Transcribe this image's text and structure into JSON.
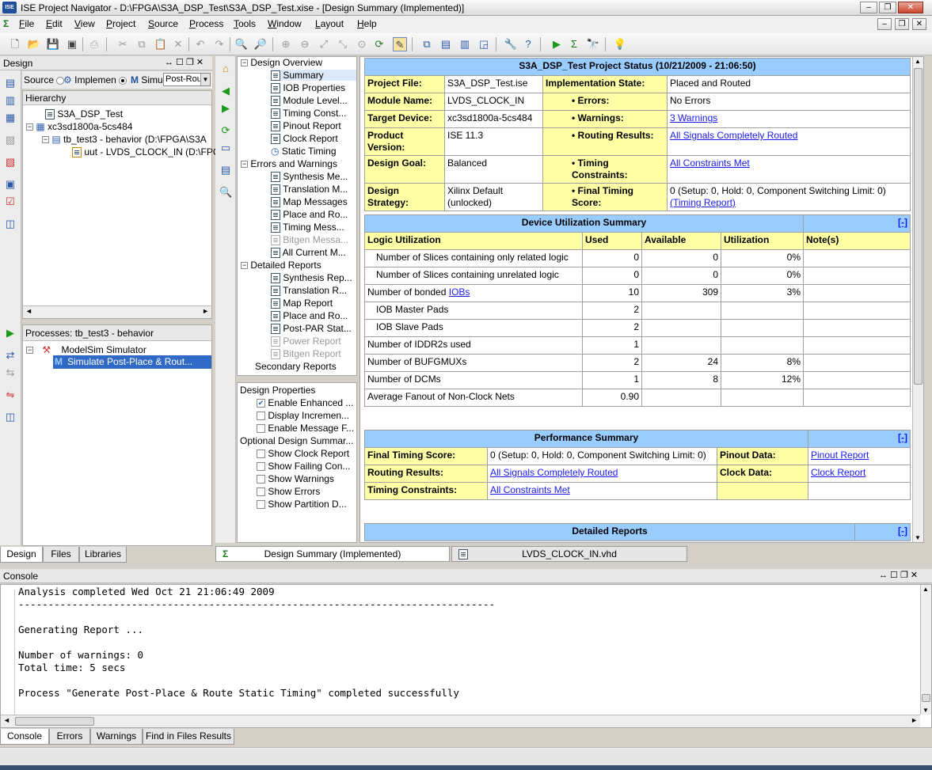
{
  "window": {
    "title": "ISE Project Navigator - D:\\FPGA\\S3A_DSP_Test\\S3A_DSP_Test.xise - [Design Summary (Implemented)]",
    "app_icon": "ISE"
  },
  "menu": [
    {
      "label": "File",
      "u": "F",
      "rest": "ile"
    },
    {
      "label": "Edit",
      "u": "E",
      "rest": "dit"
    },
    {
      "label": "View",
      "u": "V",
      "rest": "iew"
    },
    {
      "label": "Project",
      "u": "P",
      "rest": "roject"
    },
    {
      "label": "Source",
      "u": "S",
      "rest": "ource"
    },
    {
      "label": "Process",
      "u": "P",
      "rest": "rocess"
    },
    {
      "label": "Tools",
      "u": "T",
      "rest": "ools"
    },
    {
      "label": "Window",
      "u": "W",
      "rest": "indow"
    },
    {
      "label": "Layout",
      "u": "L",
      "rest": "ayout"
    },
    {
      "label": "Help",
      "u": "H",
      "rest": "elp"
    }
  ],
  "design_panel": {
    "title": "Design",
    "view_source_label": "Source",
    "view_impl_label": "Implemen",
    "sim_label": "Simu",
    "sim_select": "Post-Rou",
    "hierarchy_label": "Hierarchy",
    "tree": [
      "S3A_DSP_Test",
      "xc3sd1800a-5cs484",
      "tb_test3 - behavior (D:\\FPGA\\S3A",
      "uut - LVDS_CLOCK_IN (D:\\FPGA"
    ],
    "processes_label": "Processes: tb_test3 - behavior",
    "processes": [
      "ModelSim Simulator",
      "Simulate Post-Place & Rout..."
    ],
    "tabs": [
      "Design",
      "Files",
      "Libraries"
    ]
  },
  "summary_nav": {
    "design_overview": "Design Overview",
    "overview_items": [
      "Summary",
      "IOB Properties",
      "Module Level...",
      "Timing Const...",
      "Pinout Report",
      "Clock Report",
      "Static Timing"
    ],
    "errors_warnings": "Errors and Warnings",
    "ew_items": [
      "Synthesis Me...",
      "Translation M...",
      "Map Messages",
      "Place and Ro...",
      "Timing Mess...",
      "Bitgen Messa...",
      "All Current M..."
    ],
    "detailed_reports": "Detailed Reports",
    "dr_items": [
      "Synthesis Rep...",
      "Translation R...",
      "Map Report",
      "Place and Ro...",
      "Post-PAR Stat...",
      "Power Report",
      "Bitgen Report"
    ],
    "secondary_reports": "Secondary Reports",
    "design_properties": "Design Properties",
    "dp_items": [
      {
        "label": "Enable Enhanced ...",
        "checked": true
      },
      {
        "label": "Display Incremen...",
        "checked": false
      },
      {
        "label": "Enable Message F...",
        "checked": false
      }
    ],
    "optional_label": "Optional Design Summar...",
    "opt_items": [
      {
        "label": "Show Clock Report",
        "checked": false
      },
      {
        "label": "Show Failing Con...",
        "checked": false
      },
      {
        "label": "Show Warnings",
        "checked": false
      },
      {
        "label": "Show Errors",
        "checked": false
      },
      {
        "label": "Show Partition D...",
        "checked": false
      }
    ]
  },
  "project_status": {
    "title": "S3A_DSP_Test Project Status (10/21/2009 - 21:06:50)",
    "rows": [
      {
        "k1": "Project File:",
        "v1": "S3A_DSP_Test.ise",
        "k2": "Implementation State:",
        "v2": "Placed and Routed"
      },
      {
        "k1": "Module Name:",
        "v1": "LVDS_CLOCK_IN",
        "k2": "• Errors:",
        "v2": "No Errors"
      },
      {
        "k1": "Target Device:",
        "v1": "xc3sd1800a-5cs484",
        "k2": "• Warnings:",
        "v2": "3 Warnings"
      },
      {
        "k1": "Product Version:",
        "v1": "ISE 11.3",
        "k2": "• Routing Results:",
        "v2": "All Signals Completely Routed"
      },
      {
        "k1": "Design Goal:",
        "v1": "Balanced",
        "k2": "• Timing Constraints:",
        "v2": "All Constraints Met"
      },
      {
        "k1": "Design Strategy:",
        "v1": "Xilinx Default (unlocked)",
        "k2": "• Final Timing Score:",
        "v2": "0 (Setup: 0, Hold: 0, Component Switching Limit: 0)",
        "v2_link": "(Timing Report)"
      }
    ]
  },
  "device_util": {
    "title": "Device Utilization Summary",
    "collapse": "[-]",
    "headers": [
      "Logic Utilization",
      "Used",
      "Available",
      "Utilization",
      "Note(s)"
    ],
    "rows": [
      [
        "Number of Slices containing only related logic",
        "0",
        "0",
        "0%",
        ""
      ],
      [
        "Number of Slices containing unrelated logic",
        "0",
        "0",
        "0%",
        ""
      ],
      [
        "Number of bonded ",
        "10",
        "309",
        "3%",
        ""
      ],
      [
        "IOB Master Pads",
        "2",
        "",
        "",
        ""
      ],
      [
        "IOB Slave Pads",
        "2",
        "",
        "",
        ""
      ],
      [
        "Number of IDDR2s used",
        "1",
        "",
        "",
        ""
      ],
      [
        "Number of BUFGMUXs",
        "2",
        "24",
        "8%",
        ""
      ],
      [
        "Number of DCMs",
        "1",
        "8",
        "12%",
        ""
      ],
      [
        "Average Fanout of Non-Clock Nets",
        "0.90",
        "",
        "",
        ""
      ]
    ],
    "iobs_link": "IOBs"
  },
  "performance": {
    "title": "Performance Summary",
    "collapse": "[-]",
    "rows": [
      {
        "k1": "Final Timing Score:",
        "v1": "0 (Setup: 0, Hold: 0, Component Switching Limit: 0)",
        "k2": "Pinout Data:",
        "v2": "Pinout Report"
      },
      {
        "k1": "Routing Results:",
        "v1": "All Signals Completely Routed",
        "k2": "Clock Data:",
        "v2": "Clock Report"
      },
      {
        "k1": "Timing Constraints:",
        "v1": "All Constraints Met",
        "k2": "",
        "v2": ""
      }
    ]
  },
  "detailed_reports_section": {
    "title": "Detailed Reports",
    "collapse": "[-]"
  },
  "doc_tabs": [
    "Design Summary (Implemented)",
    "LVDS_CLOCK_IN.vhd"
  ],
  "console": {
    "title": "Console",
    "lines": [
      "Analysis completed Wed Oct 21 21:06:49 2009",
      "--------------------------------------------------------------------------------",
      "",
      "Generating Report ...",
      "",
      "Number of warnings: 0",
      "Total time: 5 secs",
      "",
      "Process \"Generate Post-Place & Route Static Timing\" completed successfully"
    ],
    "tabs": [
      "Console",
      "Errors",
      "Warnings",
      "Find in Files Results"
    ]
  }
}
